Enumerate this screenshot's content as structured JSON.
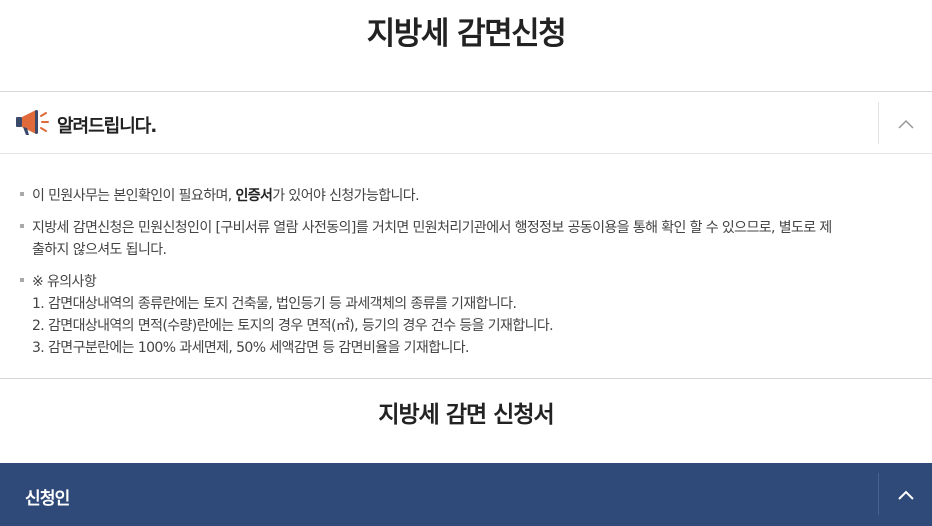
{
  "page": {
    "title": "지방세 감면신청"
  },
  "notice": {
    "title": "알려드립니다.",
    "icon": "megaphone-icon",
    "toggle_icon": "chevron-up-icon",
    "items": {
      "line1_pre": "이 민원사무는 본인확인이 필요하며, ",
      "line1_bold": "인증서",
      "line1_post": "가 있어야 신청가능합니다.",
      "line2a": "지방세 감면신청은 민원신청인이 [구비서류 열람 사전동의]를 거치면 민원처리기관에서 행정정보 공동이용을 통해 확인 할 수 있으므로, 별도로 제",
      "line2b": "출하지 않으셔도 됩니다.",
      "caution_title": "※ 유의사항",
      "caution1": "1. 감면대상내역의 종류란에는 토지 건축물, 법인등기 등 과세객체의 종류를 기재합니다.",
      "caution2": "2. 감면대상내역의 면적(수량)란에는 토지의 경우 면적(㎡), 등기의 경우 건수 등을 기재합니다.",
      "caution3": "3. 감면구분란에는 100% 과세면제, 50% 세액감면 등 감면비율을 기재합니다."
    }
  },
  "form": {
    "title": "지방세 감면 신청서"
  },
  "applicant": {
    "label": "신청인",
    "toggle_icon": "chevron-up-icon"
  },
  "colors": {
    "accent_bar": "#2f4a78",
    "megaphone": "#e06a3a"
  }
}
